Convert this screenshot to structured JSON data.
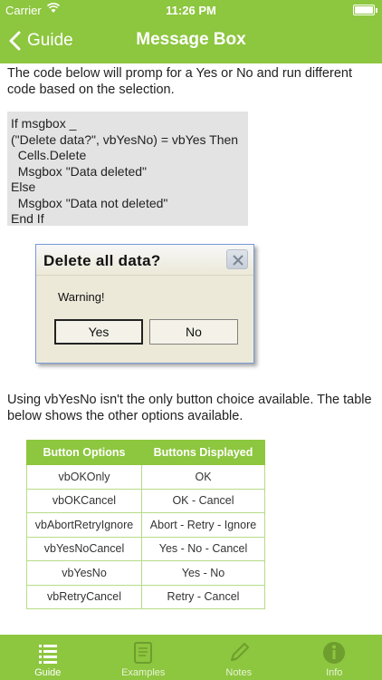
{
  "status": {
    "carrier": "Carrier",
    "time": "11:26 PM"
  },
  "nav": {
    "back_label": "Guide",
    "title": "Message Box"
  },
  "intro": "The code below will promp for a Yes or No and run different code based on the selection.",
  "code": "If msgbox _\n(\"Delete data?\", vbYesNo) = vbYes Then\n  Cells.Delete\n  Msgbox \"Data deleted\"\nElse\n  Msgbox \"Data not deleted\"\nEnd If",
  "dialog": {
    "title": "Delete all data?",
    "message": "Warning!",
    "yes": "Yes",
    "no": "No"
  },
  "description": "Using vbYesNo isn't the only button choice available. The table below shows the other options available.",
  "table": {
    "headers": [
      "Button Options",
      "Buttons Displayed"
    ],
    "rows": [
      [
        "vbOKOnly",
        "OK"
      ],
      [
        "vbOKCancel",
        "OK - Cancel"
      ],
      [
        "vbAbortRetryIgnore",
        "Abort - Retry - Ignore"
      ],
      [
        "vbYesNoCancel",
        "Yes - No - Cancel"
      ],
      [
        "vbYesNo",
        "Yes - No"
      ],
      [
        "vbRetryCancel",
        "Retry - Cancel"
      ]
    ]
  },
  "tabs": [
    {
      "label": "Guide",
      "icon": "list-icon"
    },
    {
      "label": "Examples",
      "icon": "scroll-icon"
    },
    {
      "label": "Notes",
      "icon": "pencil-icon"
    },
    {
      "label": "Info",
      "icon": "info-icon"
    }
  ],
  "colors": {
    "accent": "#8dc63f",
    "dialog_bg": "#ece9d8"
  }
}
